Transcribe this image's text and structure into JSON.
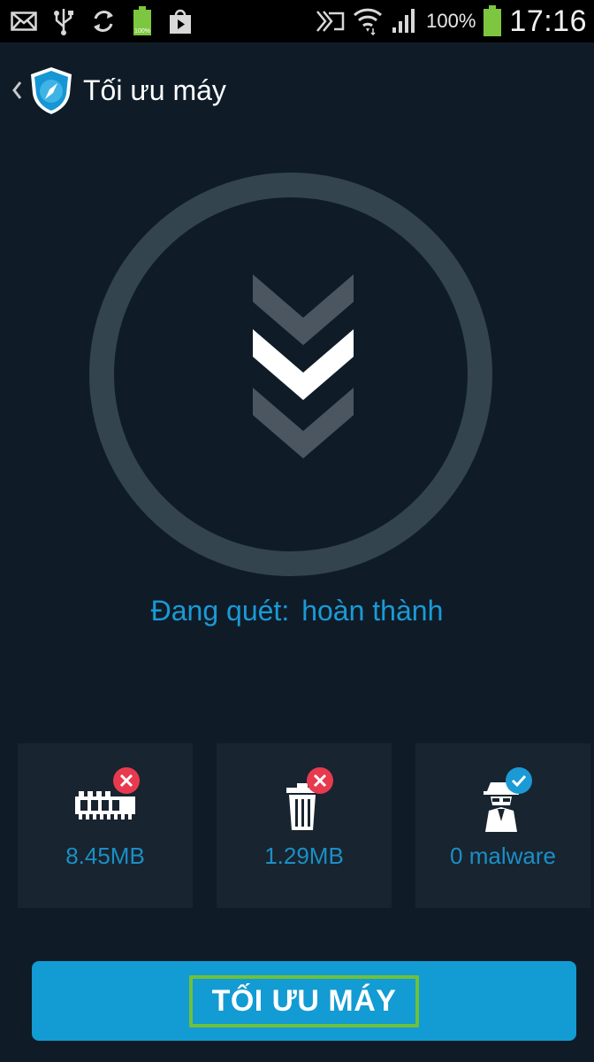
{
  "status_bar": {
    "battery_percent": "100%",
    "time": "17:16",
    "left_icons": [
      "mail-icon",
      "usb-icon",
      "sync-icon",
      "battery-charge-icon",
      "play-store-icon"
    ],
    "right_icons": [
      "nfc-icon",
      "wifi-icon",
      "signal-icon",
      "battery-icon"
    ],
    "battery_level_percent": 100,
    "accent_green": "#7cc73f"
  },
  "header": {
    "title": "Tối ưu máy",
    "back_icon": "chevron-left-icon",
    "logo_icon": "shield-compass-icon"
  },
  "scan": {
    "label": "Đang quét:",
    "result": "hoàn thành",
    "color": "#1b9ad6"
  },
  "stats": [
    {
      "icon": "ram-chip-icon",
      "badge": "error-badge-icon",
      "value": "8.45MB"
    },
    {
      "icon": "trash-can-icon",
      "badge": "error-badge-icon",
      "value": "1.29MB"
    },
    {
      "icon": "spy-agent-icon",
      "badge": "check-badge-icon",
      "value": "0 malware"
    }
  ],
  "optimize_button": {
    "label": "TỐI ƯU MÁY",
    "color": "#139bd3",
    "highlight_color": "#6ec13a"
  },
  "colors": {
    "background": "#0f1c28",
    "card": "#18242f",
    "ring": "#33444f"
  }
}
